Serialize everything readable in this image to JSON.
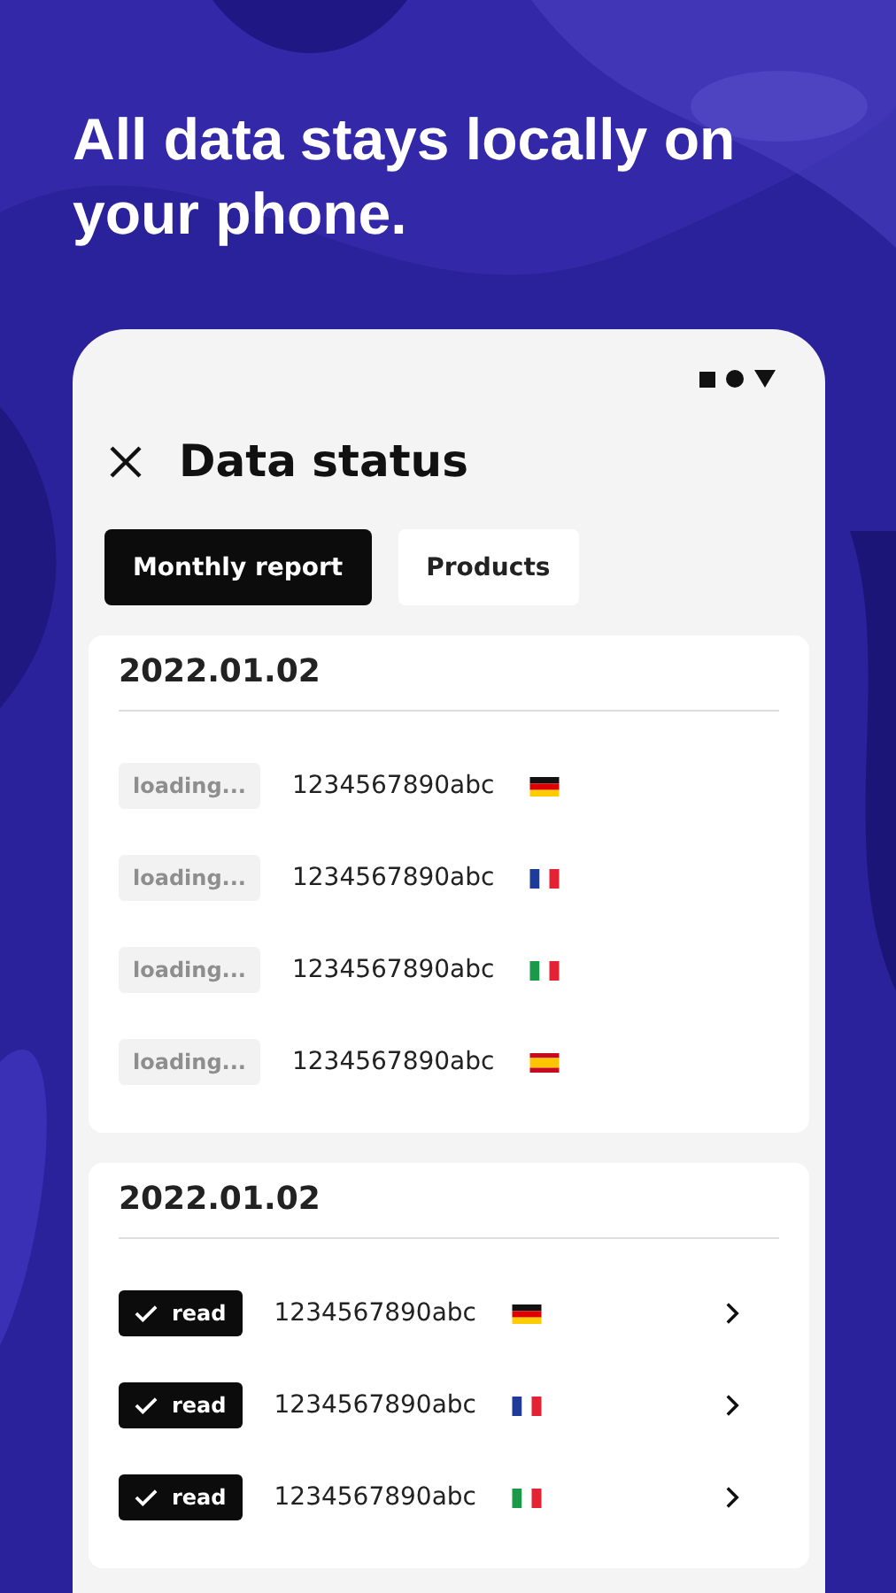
{
  "headline": "All data stays locally on your phone.",
  "screen": {
    "title": "Data status",
    "tabs": [
      {
        "label": "Monthly report",
        "selected": true
      },
      {
        "label": "Products",
        "selected": false
      }
    ],
    "cards": [
      {
        "date": "2022.01.02",
        "rows": [
          {
            "kind": "loading",
            "label": "loading...",
            "id": "1234567890abc",
            "flag": {
              "kind": "de"
            }
          },
          {
            "kind": "loading",
            "label": "loading...",
            "id": "1234567890abc",
            "flag": {
              "kind": "fr"
            }
          },
          {
            "kind": "loading",
            "label": "loading...",
            "id": "1234567890abc",
            "flag": {
              "kind": "it"
            }
          },
          {
            "kind": "loading",
            "label": "loading...",
            "id": "1234567890abc",
            "flag": {
              "kind": "es"
            }
          }
        ]
      },
      {
        "date": "2022.01.02",
        "rows": [
          {
            "kind": "read",
            "label": "read",
            "id": "1234567890abc",
            "flag": {
              "kind": "de"
            }
          },
          {
            "kind": "read",
            "label": "read",
            "id": "1234567890abc",
            "flag": {
              "kind": "fr"
            }
          },
          {
            "kind": "read",
            "label": "read",
            "id": "1234567890abc",
            "flag": {
              "kind": "it"
            }
          }
        ]
      }
    ]
  }
}
